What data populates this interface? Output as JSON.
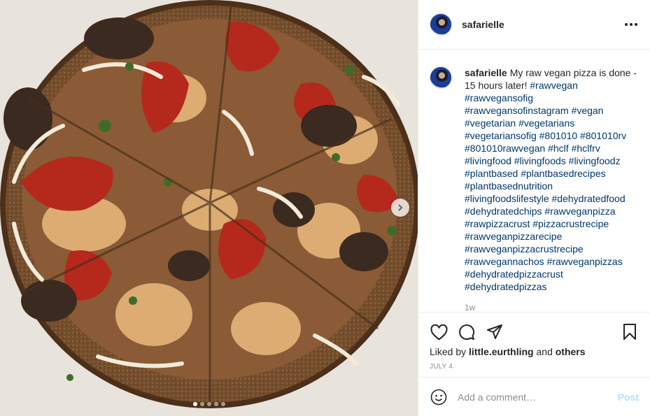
{
  "post": {
    "username": "safarielle",
    "image_alt": "Raw vegan pizza with sun-dried tomatoes, mushrooms and onions",
    "carousel": {
      "count": 5,
      "active": 0
    }
  },
  "header": {
    "username": "safarielle"
  },
  "caption": {
    "username": "safarielle",
    "text": "My raw vegan pizza is done - 15 hours later!",
    "hashtags": [
      "#rawvegan",
      "#rawvegansofig",
      "#rawvegansofinstagram",
      "#vegan",
      "#vegetarian",
      "#vegetarians",
      "#vegetariansofig",
      "#801010",
      "#801010rv",
      "#801010rawvegan",
      "#hclf",
      "#hclfrv",
      "#livingfood",
      "#livingfoods",
      "#livingfoodz",
      "#plantbased",
      "#plantbasedrecipes",
      "#plantbasednutrition",
      "#livingfoodslifestyle",
      "#dehydratedfood",
      "#dehydratedchips",
      "#rawveganpizza",
      "#rawpizzacrust",
      "#pizzacrustrecipe",
      "#rawveganpizzarecipe",
      "#rawveganpizzacrustrecipe",
      "#rawvegannachos",
      "#rawveganpizzas",
      "#dehydratedpizzacrust",
      "#dehydratedpizzas"
    ],
    "time": "1w"
  },
  "likes": {
    "prefix": "Liked by",
    "user": "little.eurthling",
    "joiner": "and",
    "others": "others"
  },
  "date": "JULY 4",
  "comment_box": {
    "placeholder": "Add a comment…",
    "post_label": "Post"
  },
  "icons": {
    "more": "more-options-icon",
    "like": "heart-icon",
    "comment": "comment-bubble-icon",
    "share": "paper-plane-icon",
    "save": "bookmark-icon",
    "emoji": "smiley-icon",
    "next": "chevron-right-icon"
  },
  "colors": {
    "hashtag": "#00376b",
    "post_button_disabled": "#b2dffc",
    "muted": "#8e8e8e",
    "text": "#262626"
  }
}
